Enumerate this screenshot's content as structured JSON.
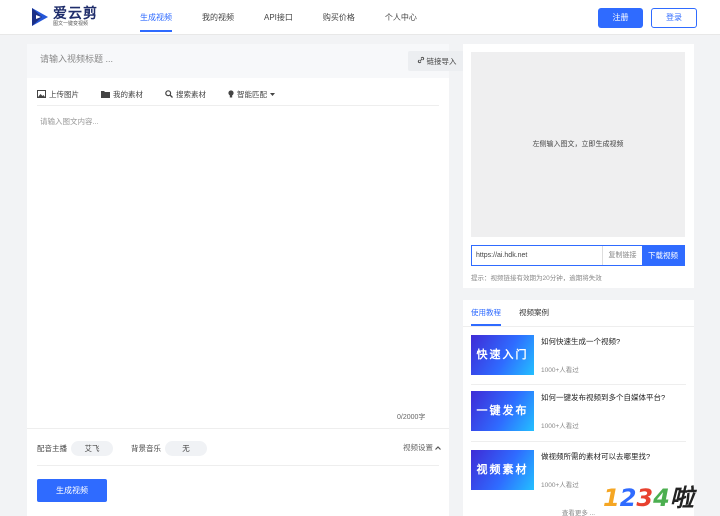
{
  "brand": {
    "name": "爱云剪",
    "slogan": "图文一键变视频",
    "accent": "#2f6bff"
  },
  "nav": {
    "items": [
      {
        "label": "生成视频",
        "active": true
      },
      {
        "label": "我的视频",
        "active": false
      },
      {
        "label": "API接口",
        "active": false
      },
      {
        "label": "购买价格",
        "active": false
      },
      {
        "label": "个人中心",
        "active": false
      }
    ],
    "register": "注册",
    "login": "登录"
  },
  "editor": {
    "title_placeholder": "请输入视频标题 ...",
    "link_import": "链接导入",
    "toolbar": {
      "upload_image": "上传图片",
      "my_assets": "我的素材",
      "search_assets": "搜索素材",
      "smart_match": "智能匹配"
    },
    "content_placeholder": "请输入图文内容...",
    "char_count": "0/2000字",
    "voice_label": "配音主播",
    "voice_value": "艾飞",
    "music_label": "背景音乐",
    "music_value": "无",
    "video_settings": "视频设置",
    "generate": "生成视频"
  },
  "preview": {
    "empty_text": "左侧输入图文，立即生成视频",
    "link_value": "https://ai.hdk.net",
    "copy_link": "复制链接",
    "download": "下载视频",
    "hint": "提示：视频链接有效期为20分钟，逾期将失效"
  },
  "tutorials": {
    "tabs": [
      {
        "label": "使用教程",
        "active": true
      },
      {
        "label": "视频案例",
        "active": false
      }
    ],
    "articles": [
      {
        "thumb": "快速入门",
        "title": "如何快速生成一个视频?",
        "views": "1000+人看过"
      },
      {
        "thumb": "一键发布",
        "title": "如何一键发布视频到多个自媒体平台?",
        "views": "1000+人看过"
      },
      {
        "thumb": "视频素材",
        "title": "做视频所需的素材可以去哪里找?",
        "views": "1000+人看过"
      }
    ],
    "more": "查看更多 ..."
  },
  "watermark": {
    "text": "1234啦"
  }
}
